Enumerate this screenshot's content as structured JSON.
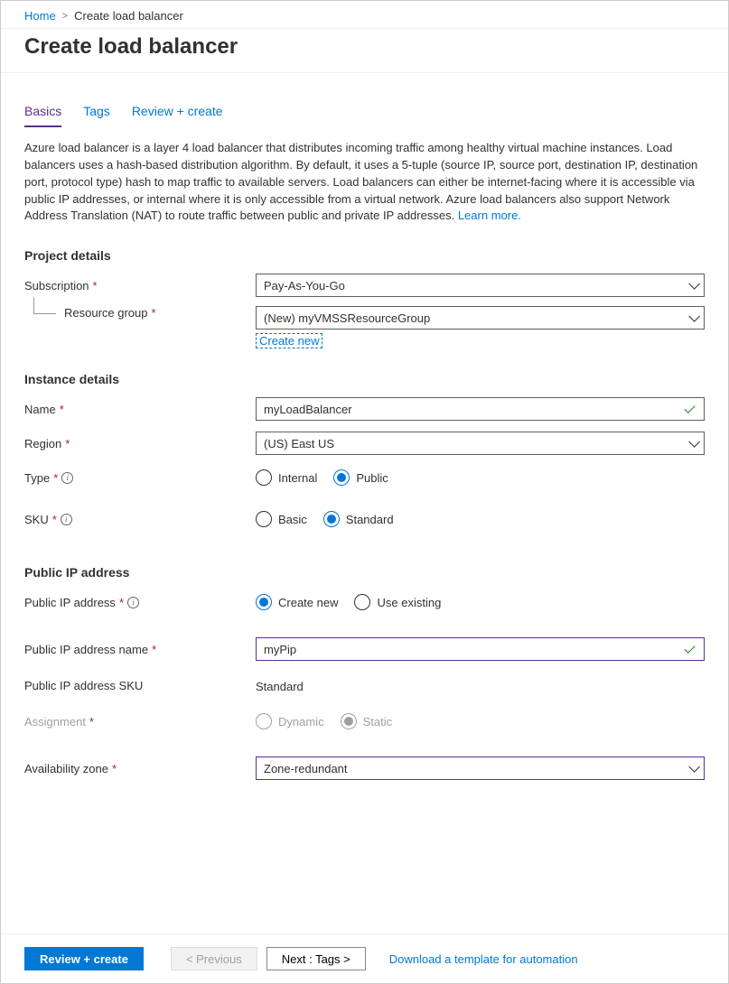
{
  "breadcrumb": {
    "home": "Home",
    "current": "Create load balancer"
  },
  "page_title": "Create load balancer",
  "tabs": {
    "basics": "Basics",
    "tags": "Tags",
    "review": "Review + create"
  },
  "description": "Azure load balancer is a layer 4 load balancer that distributes incoming traffic among healthy virtual machine instances. Load balancers uses a hash-based distribution algorithm. By default, it uses a 5-tuple (source IP, source port, destination IP, destination port, protocol type) hash to map traffic to available servers. Load balancers can either be internet-facing where it is accessible via public IP addresses, or internal where it is only accessible from a virtual network. Azure load balancers also support Network Address Translation (NAT) to route traffic between public and private IP addresses.",
  "learn_more": "Learn more.",
  "sections": {
    "project": "Project details",
    "instance": "Instance details",
    "pip": "Public IP address"
  },
  "labels": {
    "subscription": "Subscription",
    "resource_group": "Resource group",
    "create_new": "Create new",
    "name": "Name",
    "region": "Region",
    "type": "Type",
    "sku": "SKU",
    "pip": "Public IP address",
    "pip_name": "Public IP address name",
    "pip_sku": "Public IP address SKU",
    "assignment": "Assignment",
    "avail_zone": "Availability zone"
  },
  "values": {
    "subscription": "Pay-As-You-Go",
    "resource_group": "(New) myVMSSResourceGroup",
    "name": "myLoadBalancer",
    "region": "(US) East US",
    "pip_name": "myPip",
    "pip_sku": "Standard",
    "avail_zone": "Zone-redundant"
  },
  "radios": {
    "type_internal": "Internal",
    "type_public": "Public",
    "sku_basic": "Basic",
    "sku_standard": "Standard",
    "pip_create": "Create new",
    "pip_existing": "Use existing",
    "assign_dynamic": "Dynamic",
    "assign_static": "Static"
  },
  "footer": {
    "review": "Review + create",
    "previous": "< Previous",
    "next": "Next : Tags >",
    "download": "Download a template for automation"
  }
}
